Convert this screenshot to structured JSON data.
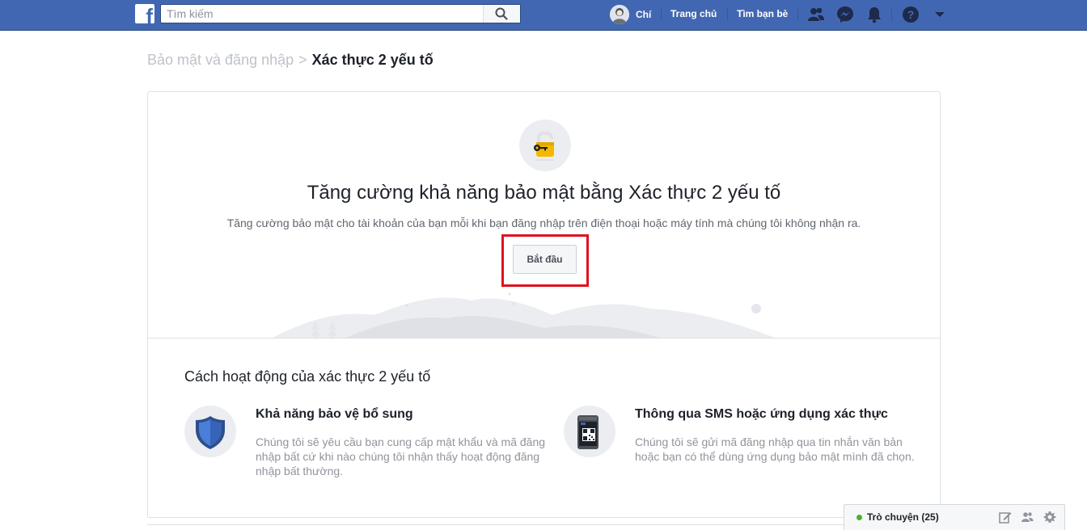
{
  "topbar": {
    "logo_letter": "f",
    "search_placeholder": "Tìm kiếm",
    "user_name": "Chí",
    "nav_home": "Trang chủ",
    "nav_find_friends": "Tìm bạn bè",
    "bg_color": "#4267b2"
  },
  "breadcrumb": {
    "parent": "Bảo mật và đăng nhập",
    "separator": ">",
    "current": "Xác thực 2 yếu tố"
  },
  "hero": {
    "title": "Tăng cường khả năng bảo mật bằng Xác thực 2 yếu tố",
    "description": "Tăng cường bảo mật cho tài khoản của bạn mỗi khi bạn đăng nhập trên điện thoại hoặc máy tính mà chúng tôi không nhận ra.",
    "start_button": "Bắt đầu",
    "highlight_color": "#e0121e"
  },
  "how_it_works": {
    "title": "Cách hoạt động của xác thực 2 yếu tố",
    "features": [
      {
        "icon": "shield-icon",
        "title": "Khả năng bảo vệ bổ sung",
        "description": "Chúng tôi sẽ yêu cầu bạn cung cấp mật khẩu và mã đăng nhập bất cứ khi nào chúng tôi nhận thấy hoạt động đăng nhập bất thường."
      },
      {
        "icon": "phone-qr-icon",
        "title": "Thông qua SMS hoặc ứng dụng xác thực",
        "description": "Chúng tôi sẽ gửi mã đăng nhập qua tin nhắn văn bản hoặc bạn có thể dùng ứng dụng bảo mật mình đã chọn."
      }
    ]
  },
  "chat": {
    "label": "Trò chuyện (25)",
    "status_color": "#42b72a"
  }
}
